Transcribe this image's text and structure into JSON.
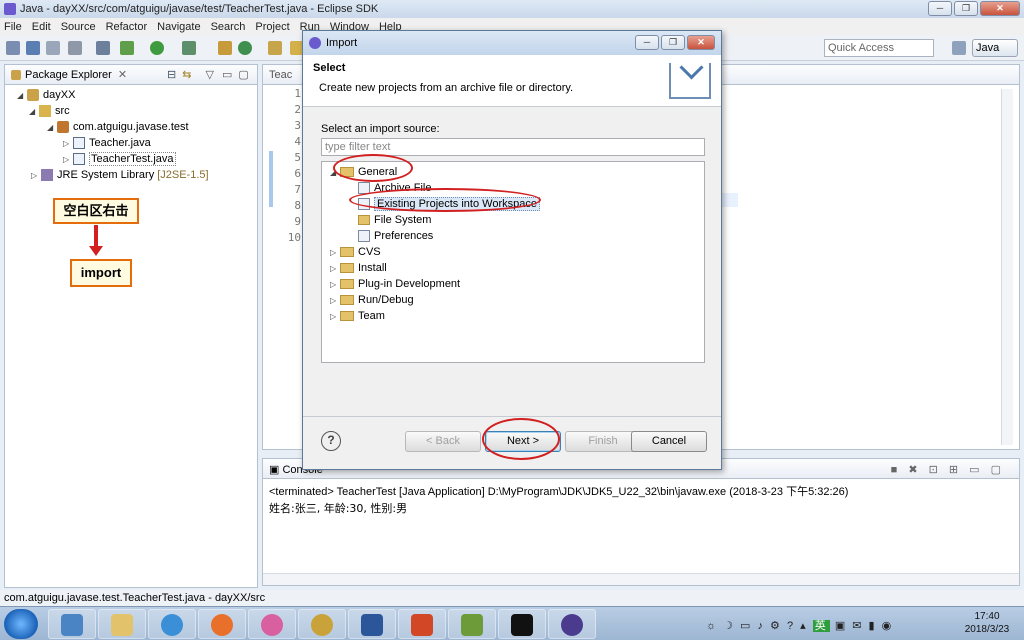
{
  "window": {
    "title": "Java - dayXX/src/com/atguigu/javase/test/TeacherTest.java - Eclipse SDK",
    "buttons": [
      "─",
      "❐",
      "✕"
    ]
  },
  "menubar": {
    "items": [
      "File",
      "Edit",
      "Source",
      "Refactor",
      "Navigate",
      "Search",
      "Project",
      "Run",
      "Window",
      "Help"
    ]
  },
  "toolbar": {
    "quick_access_placeholder": "Quick Access",
    "perspective_label": "Java"
  },
  "package_explorer": {
    "tab_label": "Package Explorer",
    "tree": {
      "project": "dayXX",
      "src": "src",
      "package": "com.atguigu.javase.test",
      "files": [
        "Teacher.java",
        "TeacherTest.java"
      ],
      "jre_label": "JRE System Library",
      "jre_version": "[J2SE-1.5]"
    }
  },
  "annotations": {
    "callout_right_click": "空白区右击",
    "callout_import": "import"
  },
  "editor": {
    "tab_label": "Teac",
    "line_numbers": [
      "1",
      "2",
      "3",
      "4",
      "5",
      "6",
      "7",
      "8",
      "9",
      "10"
    ]
  },
  "console": {
    "tab_label": "Console",
    "status": "<terminated> TeacherTest [Java Application] D:\\MyProgram\\JDK\\JDK5_U22_32\\bin\\javaw.exe (2018-3-23 下午5:32:26)",
    "output": "姓名:张三, 年龄:30, 性别:男"
  },
  "statusbar": {
    "text": "com.atguigu.javase.test.TeacherTest.java - dayXX/src"
  },
  "import_dialog": {
    "title": "Import",
    "header_title": "Select",
    "header_description": "Create new projects from an archive file or directory.",
    "source_label": "Select an import source:",
    "filter_placeholder": "type filter text",
    "categories": [
      {
        "label": "General",
        "expanded": true,
        "children": [
          "Archive File",
          "Existing Projects into Workspace",
          "File System",
          "Preferences"
        ]
      },
      {
        "label": "CVS",
        "expanded": false
      },
      {
        "label": "Install",
        "expanded": false
      },
      {
        "label": "Plug-in Development",
        "expanded": false
      },
      {
        "label": "Run/Debug",
        "expanded": false
      },
      {
        "label": "Team",
        "expanded": false
      }
    ],
    "selected_item": "Existing Projects into Workspace",
    "buttons": {
      "help": "?",
      "back": "< Back",
      "next": "Next >",
      "finish": "Finish",
      "cancel": "Cancel"
    }
  },
  "taskbar": {
    "clock_time": "17:40",
    "clock_date": "2018/3/23",
    "ime_label": "英"
  },
  "colors": {
    "annotation_red": "#d21f1f",
    "callout_border": "#e46c0a",
    "selection_blue": "#dbe8f7"
  }
}
